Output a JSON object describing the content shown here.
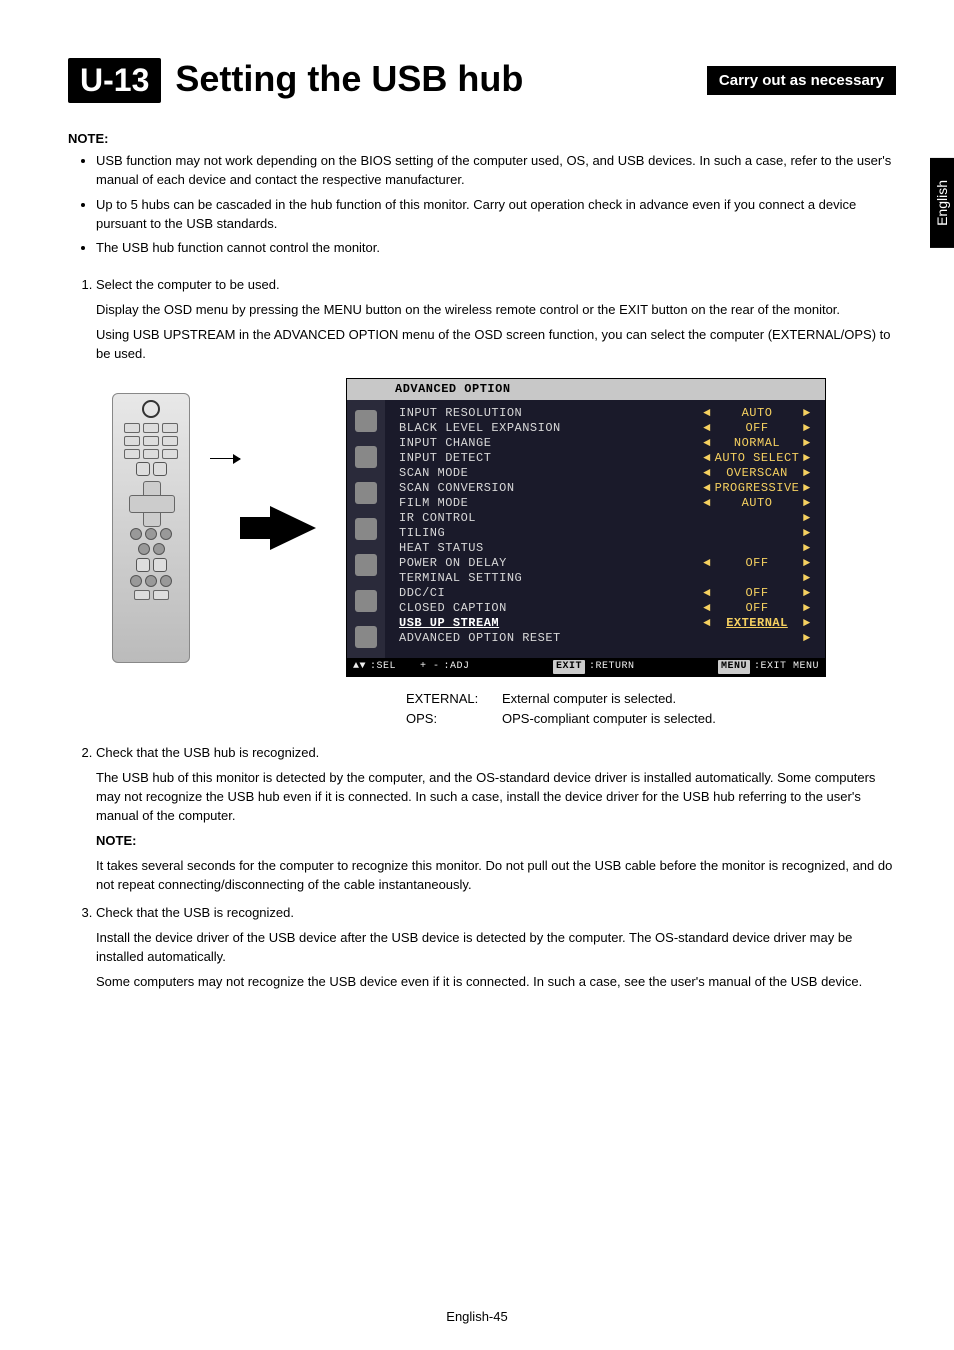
{
  "header": {
    "badge": "U-13",
    "title": "Setting the USB hub",
    "necessary": "Carry out as necessary"
  },
  "lang_tab": "English",
  "note_heading": "NOTE:",
  "notes": [
    "USB function may not work depending on the BIOS setting of the computer used, OS, and USB devices. In such a case, refer to the user's manual of each device and contact the respective manufacturer.",
    "Up to 5 hubs can be cascaded in the hub function of this monitor. Carry out operation check in advance even if you connect a device pursuant to the USB standards.",
    "The USB hub function cannot control the monitor."
  ],
  "step1": {
    "title": "Select the computer to be used.",
    "line1": "Display the OSD menu by pressing the MENU button on the wireless remote control or the EXIT button on the rear of the monitor.",
    "line2": "Using USB UPSTREAM in the ADVANCED OPTION menu of the OSD screen function, you can select the computer (EXTERNAL/OPS) to be used."
  },
  "osd": {
    "title": "ADVANCED OPTION",
    "rows": [
      {
        "label": "INPUT RESOLUTION",
        "left": true,
        "value": "AUTO",
        "right": true
      },
      {
        "label": "BLACK LEVEL EXPANSION",
        "left": true,
        "value": "OFF",
        "right": true
      },
      {
        "label": "INPUT CHANGE",
        "left": true,
        "value": "NORMAL",
        "right": true
      },
      {
        "label": "INPUT DETECT",
        "left": true,
        "value": "AUTO SELECT",
        "right": true
      },
      {
        "label": "SCAN MODE",
        "left": true,
        "value": "OVERSCAN",
        "right": true
      },
      {
        "label": "SCAN CONVERSION",
        "left": true,
        "value": "PROGRESSIVE",
        "right": true
      },
      {
        "label": "FILM MODE",
        "left": true,
        "value": "AUTO",
        "right": true
      },
      {
        "label": "IR CONTROL",
        "left": false,
        "value": "",
        "right": true,
        "noval": true
      },
      {
        "label": "TILING",
        "left": false,
        "value": "",
        "right": true,
        "noval": true
      },
      {
        "label": "HEAT STATUS",
        "left": false,
        "value": "",
        "right": true,
        "noval": true
      },
      {
        "label": "POWER ON DELAY",
        "left": true,
        "value": "OFF",
        "right": true
      },
      {
        "label": "TERMINAL SETTING",
        "left": false,
        "value": "",
        "right": true,
        "noval": true
      },
      {
        "label": "DDC/CI",
        "left": true,
        "value": "OFF",
        "right": true
      },
      {
        "label": "CLOSED CAPTION",
        "left": true,
        "value": "OFF",
        "right": true
      },
      {
        "label": "USB UP STREAM",
        "left": true,
        "value": "EXTERNAL",
        "right": true,
        "sel": true
      },
      {
        "label": "ADVANCED OPTION RESET",
        "left": false,
        "value": "",
        "right": true,
        "noval": true
      }
    ],
    "footer": {
      "sel_key": "▲▼",
      "sel": ":SEL",
      "adj_key": "+ -",
      "adj": ":ADJ",
      "ret_key": "EXIT",
      "ret": ":RETURN",
      "menu_key": "MENU",
      "menu": ":EXIT MENU"
    }
  },
  "explain": {
    "items": [
      {
        "k": "EXTERNAL:",
        "v": "External computer is selected."
      },
      {
        "k": "OPS:",
        "v": "OPS-compliant computer is selected."
      }
    ]
  },
  "step2": {
    "title": "Check that the USB hub is recognized.",
    "line1": "The USB hub of this monitor is detected by the computer, and the OS-standard device driver is installed automatically. Some computers may not recognize the USB hub even if it is connected. In such a case, install the device driver for the USB hub referring to the user's manual of the computer.",
    "note_h": "NOTE:",
    "note": "It takes several seconds for the computer to recognize this monitor. Do not pull out the USB cable before the monitor is recognized, and do not repeat connecting/disconnecting of the cable instantaneously."
  },
  "step3": {
    "title": "Check that the USB is recognized.",
    "line1": "Install the device driver of the USB device after the USB device is detected by the computer. The OS-standard device driver may be installed automatically.",
    "line2": "Some computers may not recognize the USB device even if it is connected. In such a case, see the user's manual of the USB device."
  },
  "page_no": "English-45"
}
